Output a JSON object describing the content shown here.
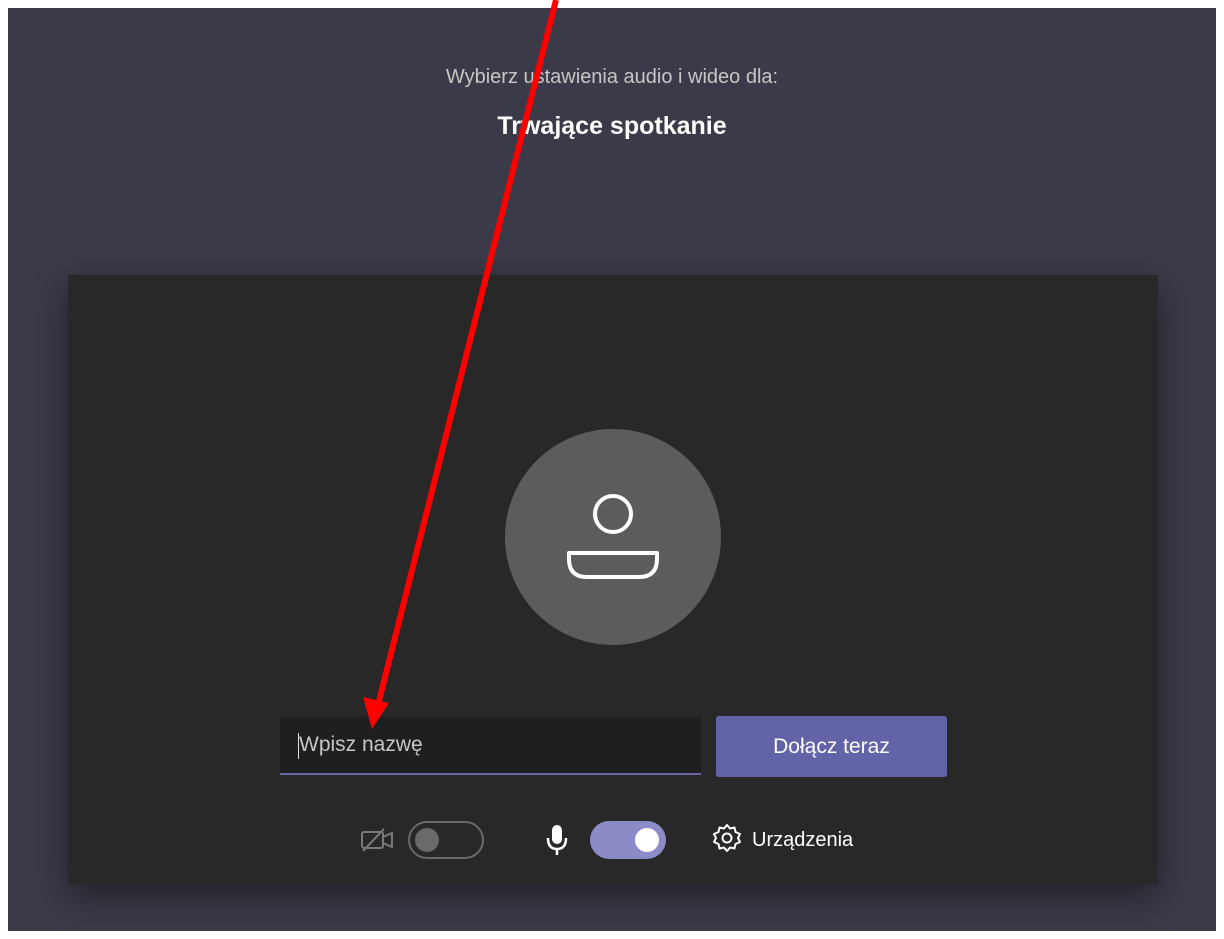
{
  "prompt": {
    "text": "Wybierz ustawienia audio i wideo dla:"
  },
  "meeting": {
    "title": "Trwające spotkanie"
  },
  "name_input": {
    "placeholder": "Wpisz nazwę",
    "value": ""
  },
  "join_button": {
    "label": "Dołącz teraz"
  },
  "controls": {
    "camera": {
      "icon": "camera-off-icon",
      "enabled": false
    },
    "microphone": {
      "icon": "microphone-icon",
      "enabled": true
    },
    "devices": {
      "icon": "gear-icon",
      "label": "Urządzenia"
    }
  },
  "avatar": {
    "icon": "person-icon"
  },
  "annotation": {
    "icon": "red-arrow-pointer"
  },
  "colors": {
    "background": "#3b3a48",
    "panel": "#292828",
    "accent": "#6264a7",
    "toggle_on": "#8b8cc7",
    "arrow": "#ff0000"
  }
}
